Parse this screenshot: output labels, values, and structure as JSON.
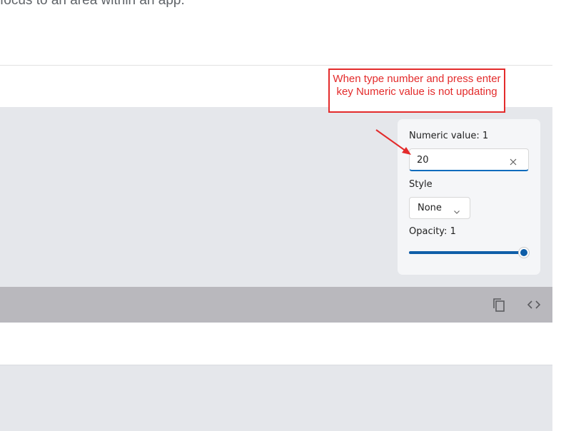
{
  "intro": {
    "text": "focus to an area within an app."
  },
  "callout": {
    "text": "When type number and press enter key Numeric value is not updating",
    "color": "#e32b2b"
  },
  "panel": {
    "numeric_label": "Numeric value:",
    "numeric_value": "1",
    "input_value": "20",
    "style_label": "Style",
    "style_selected": "None",
    "opacity_label": "Opacity:",
    "opacity_value": "1",
    "opacity_fraction": 1.0
  },
  "toolbar": {
    "copy_icon": "copy-icon",
    "code_icon": "code-icon"
  },
  "colors": {
    "accent": "#0f5ea8",
    "demo_background": "#e5e7eb",
    "toolbar_background": "#b9b8bd"
  }
}
